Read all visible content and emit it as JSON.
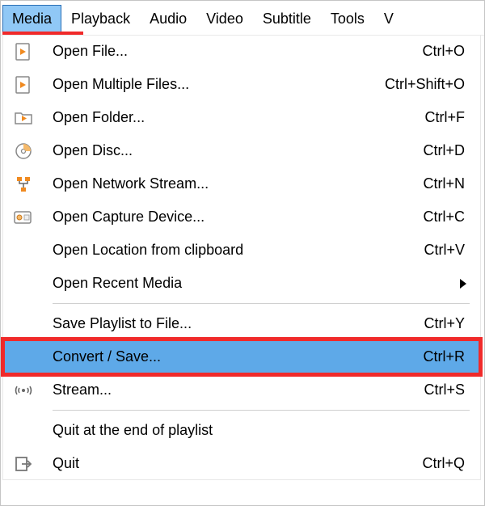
{
  "menubar": {
    "items": [
      {
        "label": "Media",
        "active": true
      },
      {
        "label": "Playback",
        "active": false
      },
      {
        "label": "Audio",
        "active": false
      },
      {
        "label": "Video",
        "active": false
      },
      {
        "label": "Subtitle",
        "active": false
      },
      {
        "label": "Tools",
        "active": false
      },
      {
        "label": "V",
        "active": false
      }
    ]
  },
  "annotations": {
    "media_underline": true,
    "convert_save_box": true
  },
  "dropdown": {
    "groups": [
      {
        "items": [
          {
            "icon": "file-play-icon",
            "label": "Open File...",
            "shortcut": "Ctrl+O"
          },
          {
            "icon": "file-play-icon",
            "label": "Open Multiple Files...",
            "shortcut": "Ctrl+Shift+O"
          },
          {
            "icon": "folder-play-icon",
            "label": "Open Folder...",
            "shortcut": "Ctrl+F"
          },
          {
            "icon": "disc-icon",
            "label": "Open Disc...",
            "shortcut": "Ctrl+D"
          },
          {
            "icon": "network-icon",
            "label": "Open Network Stream...",
            "shortcut": "Ctrl+N"
          },
          {
            "icon": "capture-icon",
            "label": "Open Capture Device...",
            "shortcut": "Ctrl+C"
          },
          {
            "icon": "",
            "label": "Open Location from clipboard",
            "shortcut": "Ctrl+V"
          },
          {
            "icon": "",
            "label": "Open Recent Media",
            "shortcut": "",
            "submenu": true
          }
        ]
      },
      {
        "items": [
          {
            "icon": "",
            "label": "Save Playlist to File...",
            "shortcut": "Ctrl+Y"
          },
          {
            "icon": "",
            "label": "Convert / Save...",
            "shortcut": "Ctrl+R",
            "highlight": true
          },
          {
            "icon": "stream-icon",
            "label": "Stream...",
            "shortcut": "Ctrl+S"
          }
        ]
      },
      {
        "items": [
          {
            "icon": "",
            "label": "Quit at the end of playlist",
            "shortcut": ""
          },
          {
            "icon": "quit-icon",
            "label": "Quit",
            "shortcut": "Ctrl+Q"
          }
        ]
      }
    ]
  }
}
